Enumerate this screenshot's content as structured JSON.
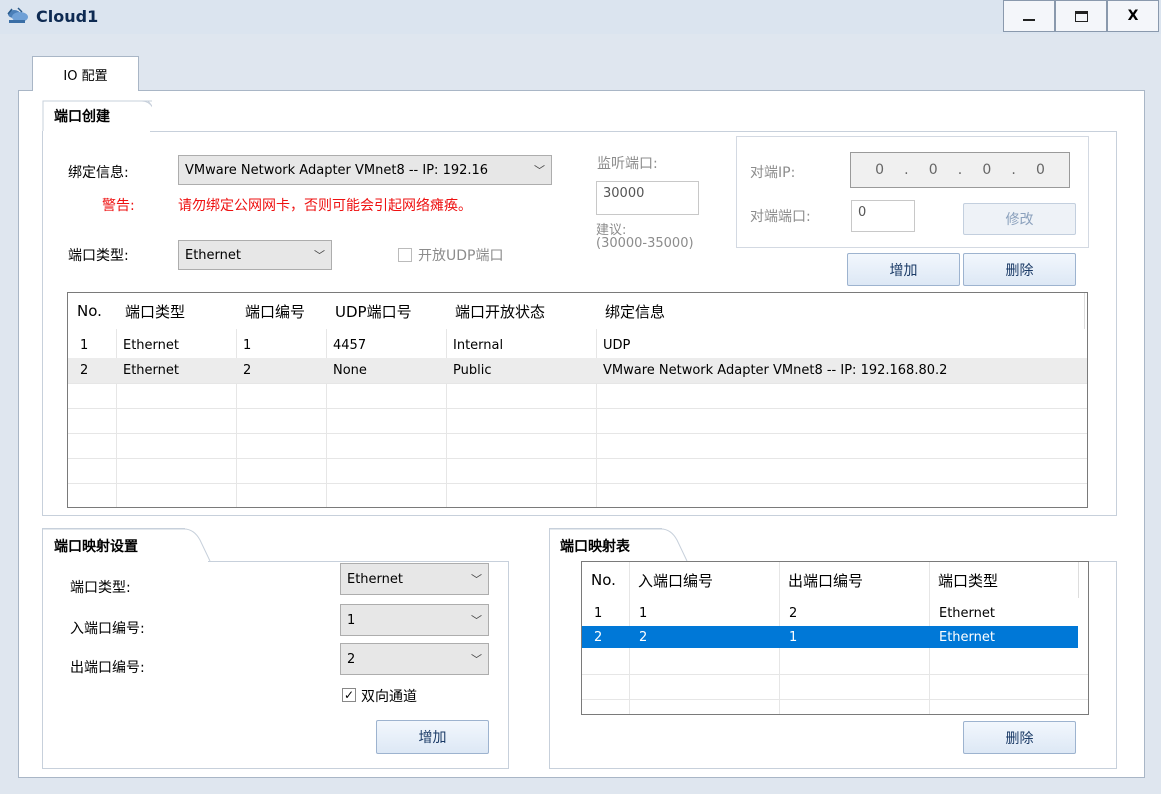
{
  "window": {
    "title": "Cloud1",
    "controls": {
      "minimize": "_",
      "maximize": "☐",
      "close": "X"
    }
  },
  "tabs": {
    "io_config": "IO 配置"
  },
  "port_creation": {
    "section_title": "端口创建",
    "binding_label": "绑定信息:",
    "binding_value": "VMware Network Adapter VMnet8 -- IP: 192.16",
    "warning_label": "警告:",
    "warning_text": "请勿绑定公网网卡，否则可能会引起网络瘫痪。",
    "port_type_label": "端口类型:",
    "port_type_value": "Ethernet",
    "open_udp_label": "开放UDP端口",
    "listen_port_label": "监听端口:",
    "listen_port_value": "30000",
    "suggest_label": "建议:",
    "suggest_range": "(30000-35000)",
    "peer_ip_label": "对端IP:",
    "peer_ip_octets": [
      "0",
      "0",
      "0",
      "0"
    ],
    "peer_ip_dot": ".",
    "peer_port_label": "对端端口:",
    "peer_port_value": "0",
    "modify_button": "修改",
    "add_button": "增加",
    "delete_button": "删除"
  },
  "port_table": {
    "headers": [
      "No.",
      "端口类型",
      "端口编号",
      "UDP端口号",
      "端口开放状态",
      "绑定信息"
    ],
    "rows": [
      [
        "1",
        "Ethernet",
        "1",
        "4457",
        "Internal",
        "UDP"
      ],
      [
        "2",
        "Ethernet",
        "2",
        "None",
        "Public",
        "VMware Network Adapter VMnet8 -- IP: 192.168.80.2"
      ]
    ]
  },
  "mapping_settings": {
    "section_title": "端口映射设置",
    "port_type_label": "端口类型:",
    "port_type_value": "Ethernet",
    "in_port_label": "入端口编号:",
    "in_port_value": "1",
    "out_port_label": "出端口编号:",
    "out_port_value": "2",
    "bidirectional_label": "双向通道",
    "bidirectional_checked": "✓",
    "add_button": "增加"
  },
  "mapping_table": {
    "section_title": "端口映射表",
    "headers": [
      "No.",
      "入端口编号",
      "出端口编号",
      "端口类型"
    ],
    "rows": [
      [
        "1",
        "1",
        "2",
        "Ethernet"
      ],
      [
        "2",
        "2",
        "1",
        "Ethernet"
      ]
    ],
    "delete_button": "删除"
  },
  "colors": {
    "selected_row": "#0078d7",
    "warning": "#ee1111"
  }
}
